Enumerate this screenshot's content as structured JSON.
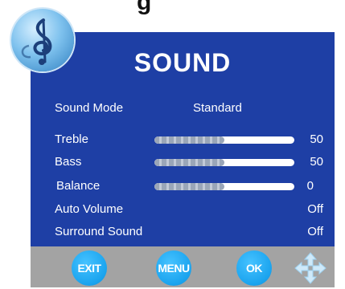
{
  "title": "SOUND",
  "top_caption": "g",
  "menu": {
    "sound_mode": {
      "label": "Sound Mode",
      "value": "Standard"
    },
    "treble": {
      "label": "Treble",
      "value": "50",
      "level": 0.5
    },
    "bass": {
      "label": "Bass",
      "value": "50",
      "level": 0.5
    },
    "balance": {
      "label": "Balance",
      "value": "0",
      "level": 0.5
    },
    "auto_volume": {
      "label": "Auto Volume",
      "value": "Off"
    },
    "surround_sound": {
      "label": "Surround Sound",
      "value": "Off"
    }
  },
  "buttons": {
    "exit": "EXIT",
    "menu": "MENU",
    "ok": "OK"
  },
  "icons": {
    "logo": "treble-clef-icon",
    "nav": "arrow-cross-icon"
  },
  "colors": {
    "panel": "#1e3fa5",
    "button": "#1aa3ee",
    "bar": "#a3a3a3"
  }
}
